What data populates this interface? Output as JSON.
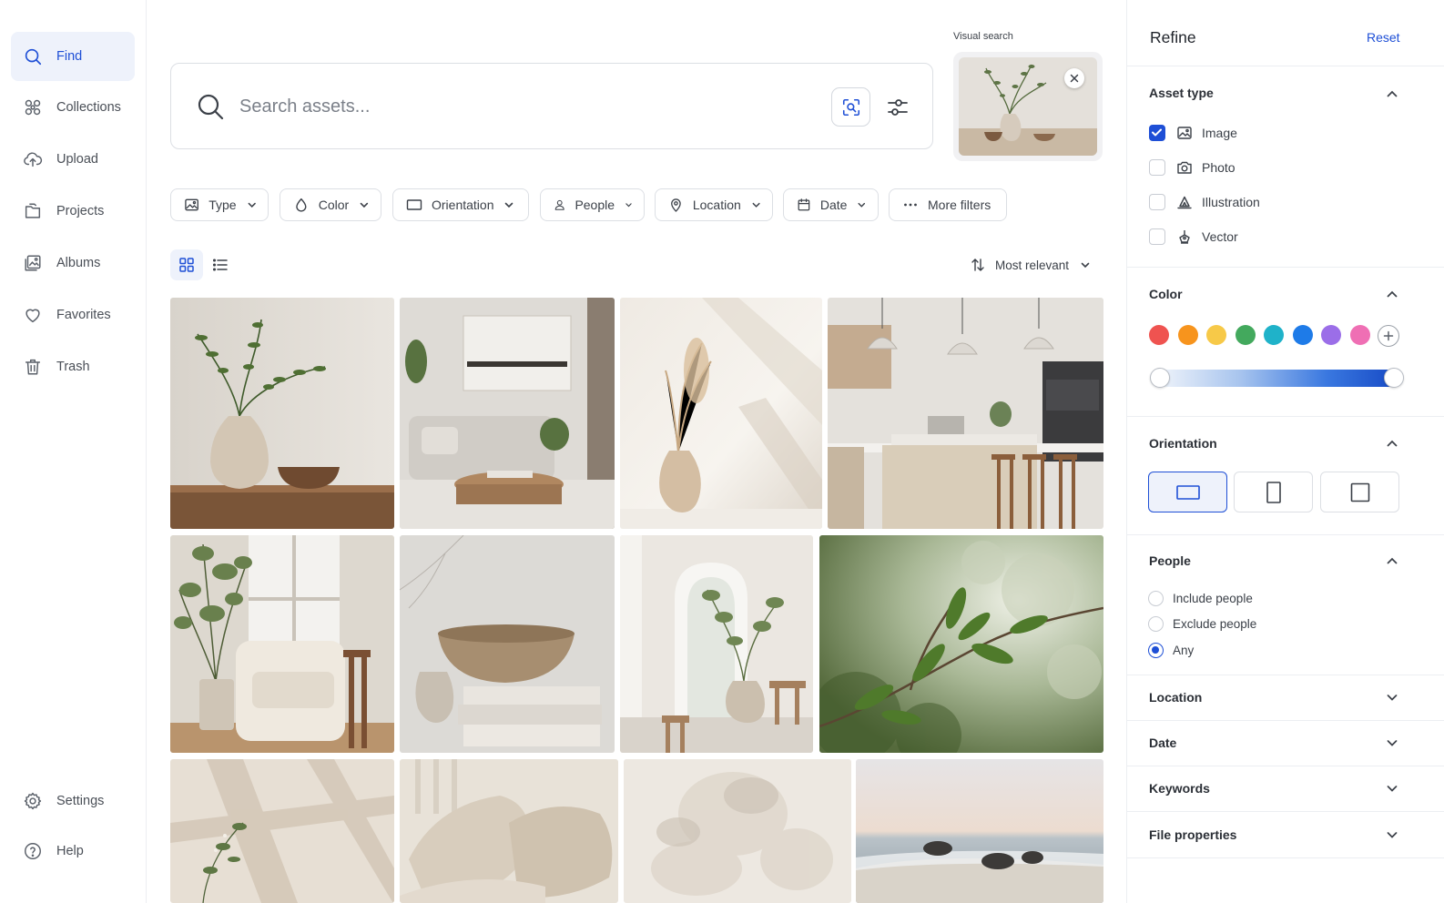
{
  "sidebar": {
    "items": [
      {
        "label": "Find",
        "icon": "search-icon"
      },
      {
        "label": "Collections",
        "icon": "collections-icon"
      },
      {
        "label": "Upload",
        "icon": "cloud-upload-icon"
      },
      {
        "label": "Projects",
        "icon": "folder-icon"
      },
      {
        "label": "Albums",
        "icon": "album-icon"
      },
      {
        "label": "Favorites",
        "icon": "heart-icon"
      },
      {
        "label": "Trash",
        "icon": "trash-icon"
      }
    ],
    "bottom": [
      {
        "label": "Settings",
        "icon": "gear-icon"
      },
      {
        "label": "Help",
        "icon": "help-icon"
      }
    ]
  },
  "search": {
    "placeholder": "Search assets..."
  },
  "visual_search": {
    "label": "Visual search"
  },
  "filters": [
    "Type",
    "Color",
    "Orientation",
    "People",
    "Location",
    "Date",
    "More filters"
  ],
  "sort": {
    "label": "Most relevant"
  },
  "panel": {
    "title": "Refine",
    "reset": "Reset",
    "asset_type": {
      "title": "Asset type",
      "options": [
        {
          "label": "Image",
          "checked": true
        },
        {
          "label": "Photo",
          "checked": false
        },
        {
          "label": "Illustration",
          "checked": false
        },
        {
          "label": "Vector",
          "checked": false
        }
      ]
    },
    "color": {
      "title": "Color",
      "swatches": [
        "#ef5350",
        "#f7941d",
        "#f7c948",
        "#43a95d",
        "#1fb2c9",
        "#1e7be8",
        "#9b6ee8",
        "#ef6fb4"
      ]
    },
    "orientation": {
      "title": "Orientation",
      "selected": "landscape"
    },
    "people": {
      "title": "People",
      "options": [
        {
          "label": "Include people",
          "checked": false
        },
        {
          "label": "Exclude people",
          "checked": false
        },
        {
          "label": "Any",
          "checked": true
        }
      ]
    },
    "collapsed": [
      "Location",
      "Date",
      "Keywords",
      "File properties"
    ]
  },
  "accent": "#1e4fd6"
}
